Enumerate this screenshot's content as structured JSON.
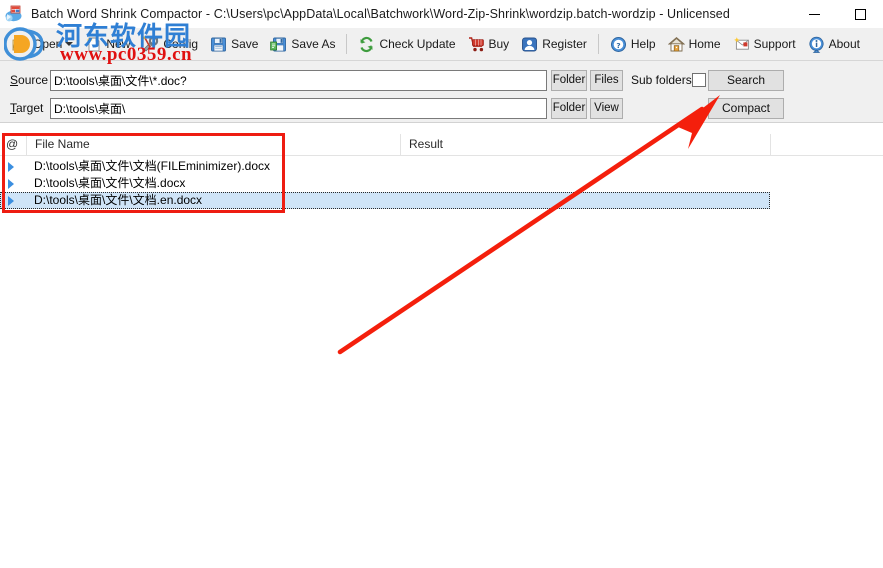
{
  "window": {
    "title": "Batch Word Shrink Compactor - C:\\Users\\pc\\AppData\\Local\\Batchwork\\Word-Zip-Shrink\\wordzip.batch-wordzip - Unlicensed",
    "app_icon": "word-shrink-app-icon",
    "controls": {
      "minimize": "minimize-icon",
      "maximize": "maximize-icon"
    }
  },
  "toolbar": {
    "items": [
      {
        "label": "Open",
        "icon": "open-folder-icon",
        "dropdown": true
      },
      {
        "label": "New",
        "icon": "new-document-icon",
        "dropdown": false
      },
      {
        "label": "Config",
        "icon": "config-tools-icon",
        "dropdown": false
      },
      {
        "label": "Save",
        "icon": "save-floppy-icon",
        "dropdown": false
      },
      {
        "label": "Save As",
        "icon": "save-as-floppy-icon",
        "dropdown": false
      },
      {
        "label": "Check Update",
        "icon": "refresh-arrows-icon",
        "dropdown": false
      },
      {
        "label": "Buy",
        "icon": "shopping-cart-icon",
        "dropdown": false
      },
      {
        "label": "Register",
        "icon": "register-user-icon",
        "dropdown": false
      },
      {
        "label": "Help",
        "icon": "help-question-icon",
        "dropdown": false
      },
      {
        "label": "Home",
        "icon": "home-house-icon",
        "dropdown": false
      },
      {
        "label": "Support",
        "icon": "support-mail-icon",
        "dropdown": false
      },
      {
        "label": "About",
        "icon": "about-info-icon",
        "dropdown": false
      }
    ]
  },
  "form": {
    "source": {
      "label": "Source",
      "label_accel": "S",
      "label_rest": "ource",
      "value": "D:\\tools\\桌面\\文件\\*.doc?",
      "placeholder": "",
      "folder_button": "Folder",
      "files_button": "Files",
      "sub_folders_label": "Sub folders",
      "sub_folders_checked": false,
      "action_button": "Search"
    },
    "target": {
      "label": "Target",
      "label_accel": "T",
      "label_rest": "arget",
      "value": "D:\\tools\\桌面\\",
      "placeholder": "",
      "folder_button": "Folder",
      "view_button": "View",
      "action_button": "Compact"
    }
  },
  "list": {
    "columns": [
      {
        "key": "at",
        "label": "@"
      },
      {
        "key": "name",
        "label": "File Name"
      },
      {
        "key": "result",
        "label": "Result"
      },
      {
        "key": "tail",
        "label": ""
      }
    ],
    "rows": [
      {
        "marker": "row-arrow-icon",
        "name": "D:\\tools\\桌面\\文件\\文档(FILEminimizer).docx",
        "result": "",
        "selected": false
      },
      {
        "marker": "row-arrow-icon",
        "name": "D:\\tools\\桌面\\文件\\文档.docx",
        "result": "",
        "selected": false
      },
      {
        "marker": "row-arrow-icon",
        "name": "D:\\tools\\桌面\\文件\\文档.en.docx",
        "result": "",
        "selected": true
      }
    ]
  },
  "annotations": {
    "highlight_box": {
      "color": "#ee1c11",
      "target": "file-list-region"
    },
    "arrow": {
      "color": "#f41f0c",
      "points_to": "compact-button"
    }
  },
  "watermark": {
    "site_name": "河东软件园",
    "site_url": "www.pc0359.cn",
    "logo": "watermark-logo-icon",
    "colors": {
      "site_name": "#2f7fd4",
      "site_url": "#e01010"
    }
  },
  "theme": {
    "window_background": "#ffffff",
    "panel_background": "#f0f0f0",
    "button_face": "#e1e1e1",
    "button_border": "#adadad",
    "field_border": "#7a7a7a",
    "selection": "#cfe4f7",
    "row_marker": "#3b8fe0"
  }
}
